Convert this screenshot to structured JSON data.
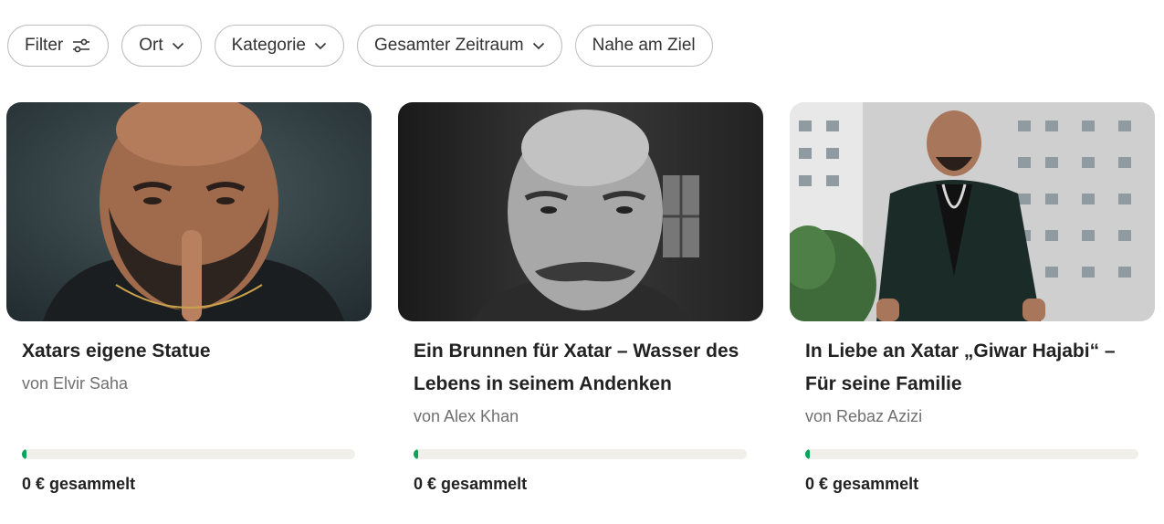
{
  "filters": {
    "filter_label": "Filter",
    "location_label": "Ort",
    "category_label": "Kategorie",
    "period_label": "Gesamter Zeitraum",
    "near_goal_label": "Nahe am Ziel"
  },
  "currency_icon": "sliders-icon",
  "colors": {
    "progress_fill": "#0aa35c",
    "progress_track": "#f0efe9",
    "border": "#bdbdbd"
  },
  "cards": [
    {
      "title": "Xatars eigene Statue",
      "author": "von Elvir Saha",
      "progress_percent": 1.5,
      "amount": "0 €",
      "amount_suffix": "gesammelt"
    },
    {
      "title": "Ein Brunnen für Xatar – Wasser des Lebens in seinem Andenken",
      "author": "von Alex Khan",
      "progress_percent": 1.5,
      "amount": "0 €",
      "amount_suffix": "gesammelt"
    },
    {
      "title": "In Liebe an Xatar „Giwar Hajabi“ – Für seine Familie",
      "author": "von Rebaz Azizi",
      "progress_percent": 1.5,
      "amount": "0 €",
      "amount_suffix": "gesammelt"
    }
  ]
}
